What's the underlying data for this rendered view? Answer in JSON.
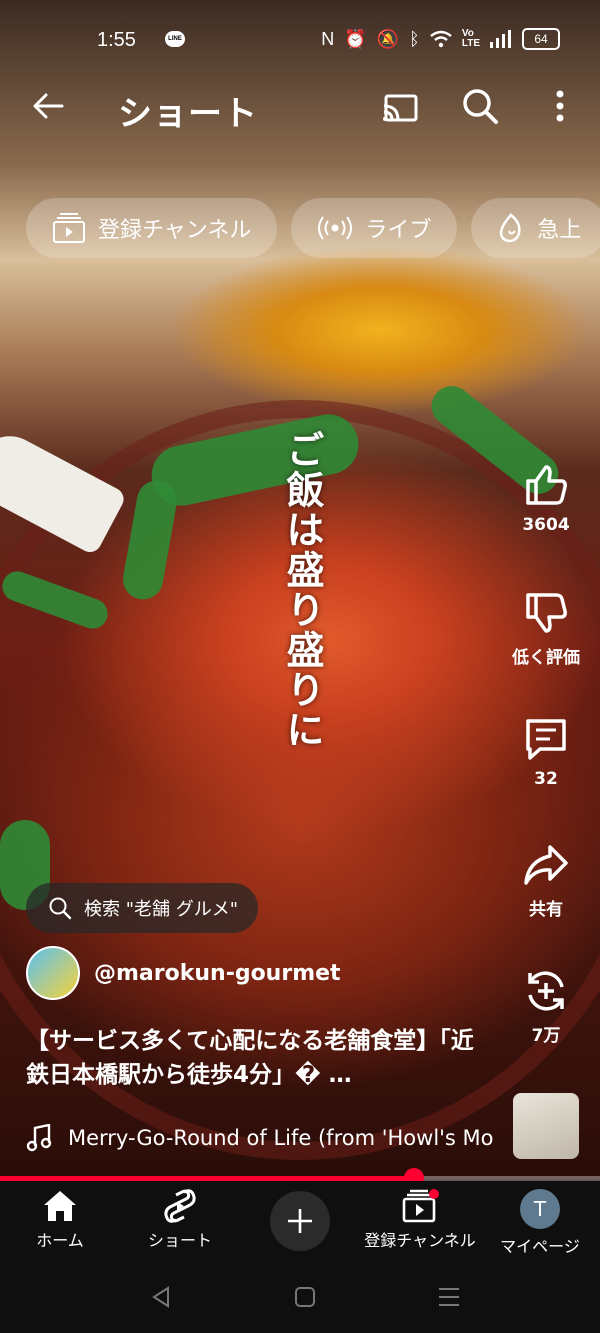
{
  "status_bar": {
    "time": "1:55",
    "line_badge": "LINE",
    "icons": [
      "nfc-icon",
      "alarm-icon",
      "mute-icon",
      "bluetooth-icon",
      "wifi-icon",
      "volte-icon",
      "signal-icon"
    ],
    "battery": "64"
  },
  "header": {
    "title": "ショート"
  },
  "chips": [
    {
      "label": "登録チャンネル",
      "icon": "subscriptions-icon"
    },
    {
      "label": "ライブ",
      "icon": "live-icon"
    },
    {
      "label": "急上",
      "icon": "trending-icon"
    }
  ],
  "video": {
    "overlay_text": "ご飯は盛り盛りに",
    "search_suggestion": "検索 \"老舗 グルメ\"",
    "channel": "@marokun-gourmet",
    "title": "【サービス多くて心配になる老舗食堂】「近鉄日本橋駅から徒歩4分」� …",
    "music": "Merry-Go-Round of Life (from 'Howl's Mo",
    "progress": 0.69
  },
  "actions": {
    "like_count": "3604",
    "dislike_label": "低く評価",
    "comment_count": "32",
    "share_label": "共有",
    "remix_count": "7万"
  },
  "nav": {
    "home": "ホーム",
    "shorts": "ショート",
    "subscriptions": "登録チャンネル",
    "mypage": "マイページ",
    "avatar_letter": "T"
  },
  "colors": {
    "accent": "#ff0033",
    "nav_bg": "#0f0f0f"
  }
}
